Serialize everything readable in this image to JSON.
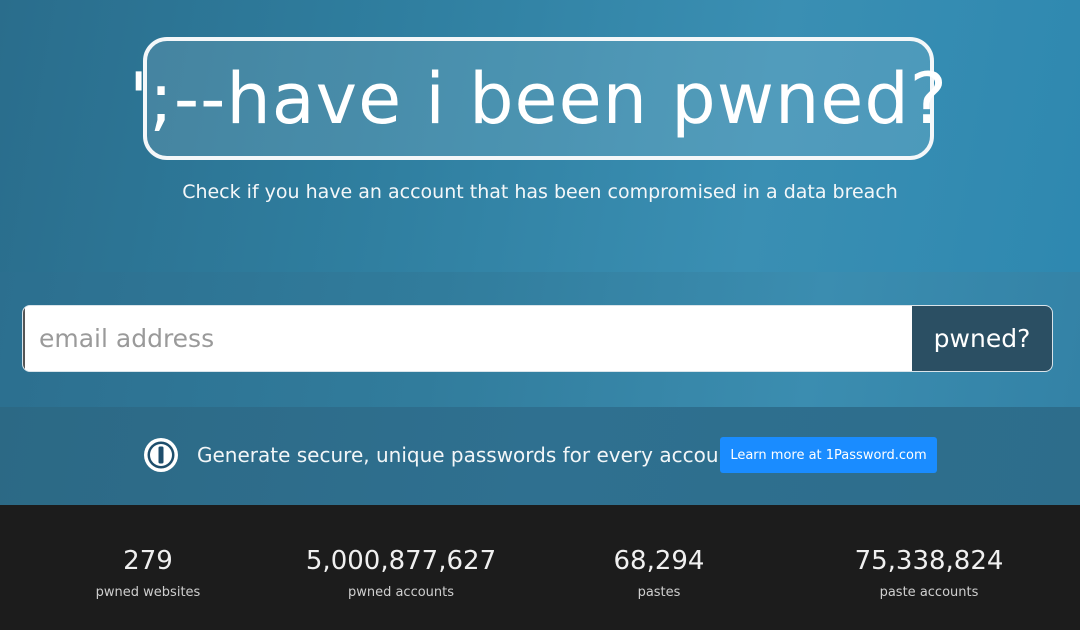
{
  "hero": {
    "title": "';--have i been pwned?",
    "tagline": "Check if you have an account that has been compromised in a data breach"
  },
  "search": {
    "placeholder": "email address",
    "value": "",
    "button_label": "pwned?"
  },
  "promo": {
    "icon": "1password-logo-icon",
    "text": "Generate secure, unique passwords for every account",
    "button_label": "Learn more at 1Password.com",
    "button_color": "#1a8cff"
  },
  "stats": [
    {
      "value": "279",
      "label": "pwned websites"
    },
    {
      "value": "5,000,877,627",
      "label": "pwned accounts"
    },
    {
      "value": "68,294",
      "label": "pastes"
    },
    {
      "value": "75,338,824",
      "label": "paste accounts"
    }
  ],
  "colors": {
    "hero_bg": "#2f7e9f",
    "search_button_bg": "#2b4f63",
    "stats_bg": "#1c1c1c"
  }
}
